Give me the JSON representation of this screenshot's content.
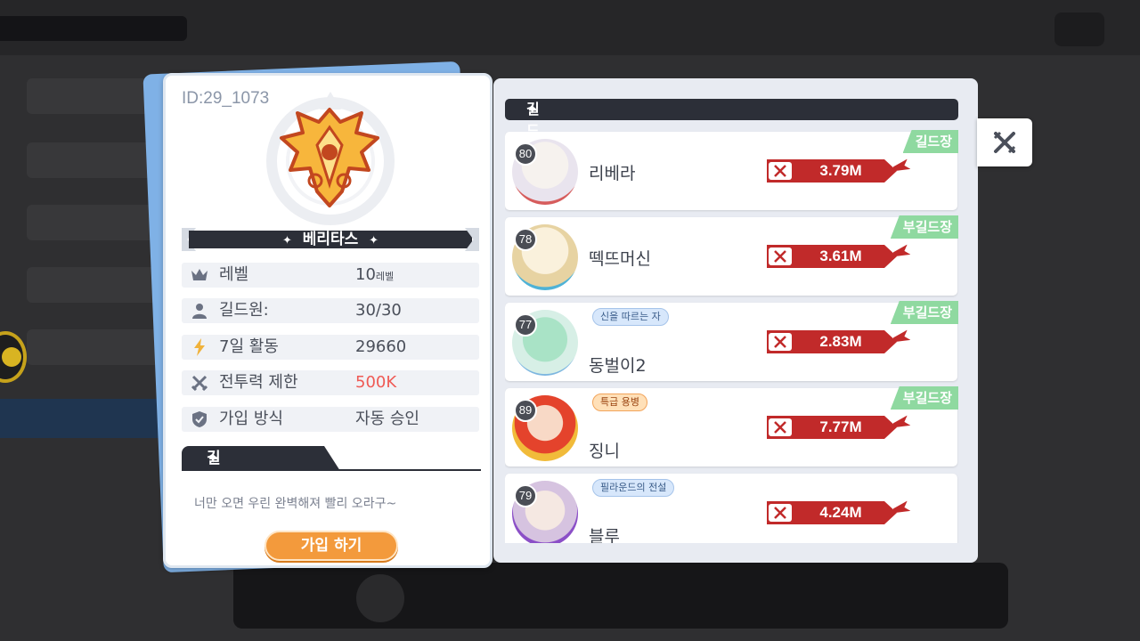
{
  "guild": {
    "id_label": "ID:29_1073",
    "name": "베리타스",
    "stats": [
      {
        "icon": "crown-icon",
        "label": "레벨",
        "value": "10",
        "unit": "레벨"
      },
      {
        "icon": "person-icon",
        "label": "길드원:",
        "value": "30/30"
      },
      {
        "icon": "lightning-icon",
        "label": "7일 활동",
        "value": "29660"
      },
      {
        "icon": "crossed-swords-icon",
        "label": "전투력 제한",
        "value": "500K",
        "value_color": "#ef5a55"
      },
      {
        "icon": "shield-icon",
        "label": "가입 방식",
        "value": "자동 승인"
      }
    ],
    "promo_title": "길드 홍보",
    "promo_text": "너만 오면 우린 완벽해져 빨리 오라구~",
    "join_button": "가입 하기"
  },
  "members_panel": {
    "header": "길드원:",
    "members": [
      {
        "level": "80",
        "name": "리베라",
        "power": "3.79M",
        "role": "길드장",
        "title": ""
      },
      {
        "level": "78",
        "name": "떽뜨머신",
        "power": "3.61M",
        "role": "부길드장",
        "title": ""
      },
      {
        "level": "77",
        "name": "동벌이2",
        "power": "2.83M",
        "role": "부길드장",
        "title": "신을 따르는 자"
      },
      {
        "level": "89",
        "name": "징니",
        "power": "7.77M",
        "role": "부길드장",
        "title": "특급 용병"
      },
      {
        "level": "79",
        "name": "블루",
        "power": "4.24M",
        "role": "",
        "title": "필라운드의 전설"
      }
    ]
  },
  "colors": {
    "dark_bar": "#2c2f38",
    "join_orange": "#f39a3c",
    "power_red": "#c12a2a",
    "role_green": "#8fd9a0",
    "limit_red": "#ef5a55"
  }
}
